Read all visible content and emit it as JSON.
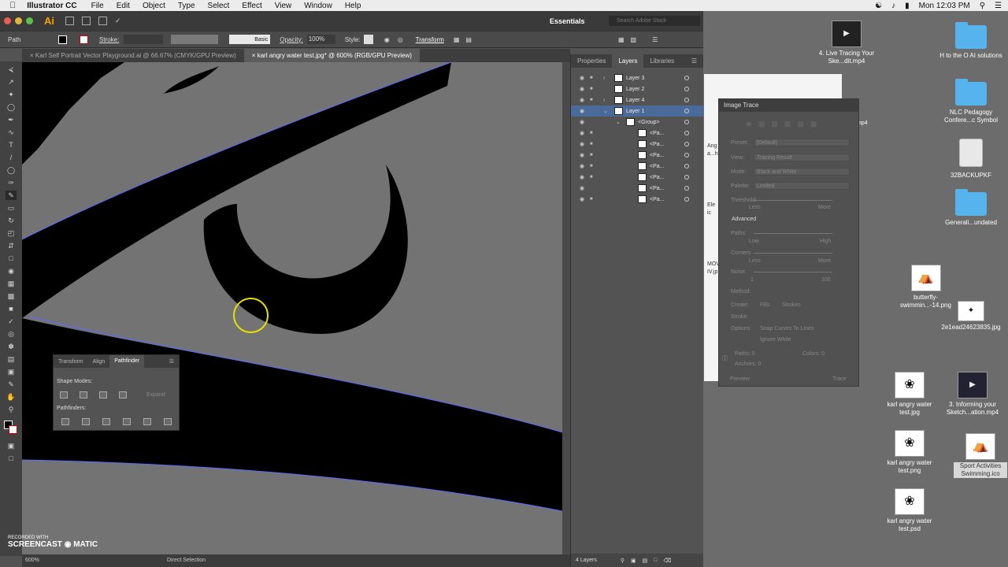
{
  "menubar": {
    "app": "Illustrator CC",
    "items": [
      "File",
      "Edit",
      "Object",
      "Type",
      "Select",
      "Effect",
      "View",
      "Window",
      "Help"
    ],
    "clock": "Mon 12:03 PM"
  },
  "apptitle": {
    "logo": "Ai",
    "workspace": "Essentials",
    "search_placeholder": "Search Adobe Stock"
  },
  "control": {
    "selection": "Path",
    "stroke_label": "Stroke:",
    "brush": "Basic",
    "opacity_label": "Opacity:",
    "opacity_value": "100%",
    "style_label": "Style:",
    "transform": "Transform"
  },
  "tabs": [
    "Karl Self Portrait Vector Playground.ai @ 66.67% (CMYK/GPU Preview)",
    "karl angry water test.jpg* @ 600% (RGB/GPU Preview)"
  ],
  "status": {
    "zoom": "600%",
    "tool": "Direct Selection"
  },
  "layers_panel": {
    "tabs": [
      "Properties",
      "Layers",
      "Libraries"
    ],
    "rows": [
      "Layer 3",
      "Layer 2",
      "Layer 4",
      "Layer 1",
      "<Group>",
      "<Pa...",
      "<Pa...",
      "<Pa...",
      "<Pa...",
      "<Pa...",
      "<Pa...",
      "<Pa..."
    ],
    "footer": "4 Layers"
  },
  "pathfinder": {
    "tabs": [
      "Transform",
      "Align",
      "Pathfinder"
    ],
    "shape_modes": "Shape Modes:",
    "expand": "Expand",
    "pathfinders": "Pathfinders:"
  },
  "image_trace": {
    "title": "Image Trace",
    "preset_label": "Preset:",
    "preset_value": "[Default]",
    "view_label": "View:",
    "view_value": "Tracing Result",
    "mode_label": "Mode:",
    "mode_value": "Black and White",
    "palette_label": "Palette:",
    "palette_value": "Limited",
    "threshold_label": "Threshold:",
    "less": "Less",
    "more": "More",
    "advanced": "Advanced",
    "paths_label": "Paths:",
    "low": "Low",
    "high": "High",
    "corners_label": "Corners:",
    "noise_label": "Noise:",
    "noise_min": "1",
    "noise_max": "100",
    "method_label": "Method:",
    "create_label": "Create:",
    "fills": "Fills",
    "strokes": "Strokes",
    "stroke_label": "Stroke:",
    "options_label": "Options:",
    "snap": "Snap Curves To Lines",
    "ignore_white": "Ignore White",
    "paths_count": "Paths: 0",
    "colors_count": "Colors: 0",
    "anchors_count": "Anchors: 0",
    "preview": "Preview",
    "trace": "Trace"
  },
  "desktop_icons": [
    {
      "label": "4. Live Tracing Your Ske...dit.mp4",
      "kind": "video"
    },
    {
      "label": "H to the O AI solutions",
      "kind": "folder"
    },
    {
      "label": "NLC Pedagogy Confere...c Symbol",
      "kind": "folder"
    },
    {
      "label": "32BACKUPKF",
      "kind": "drive"
    },
    {
      "label": "Generali...undated",
      "kind": "folder"
    },
    {
      "label": "butterfly-swimmin...-14.png",
      "kind": "image"
    },
    {
      "label": "2e1ead24623835.jpg",
      "kind": "image"
    },
    {
      "label": "karl angry water test.jpg",
      "kind": "image"
    },
    {
      "label": "3. Informing your Sketch...ation.mp4",
      "kind": "video"
    },
    {
      "label": "karl angry water test.png",
      "kind": "image"
    },
    {
      "label": "Sport Activities Swimming.ico",
      "kind": "image"
    },
    {
      "label": "karl angry water test.psd",
      "kind": "image"
    }
  ],
  "background_window_text": [
    "Ang",
    "a...hi",
    "Ele",
    "ic",
    "MOV",
    "IV.jp",
    "mp4"
  ],
  "watermark": {
    "line1": "RECORDED WITH",
    "line2": "SCREENCAST",
    "line3": "MATIC"
  }
}
